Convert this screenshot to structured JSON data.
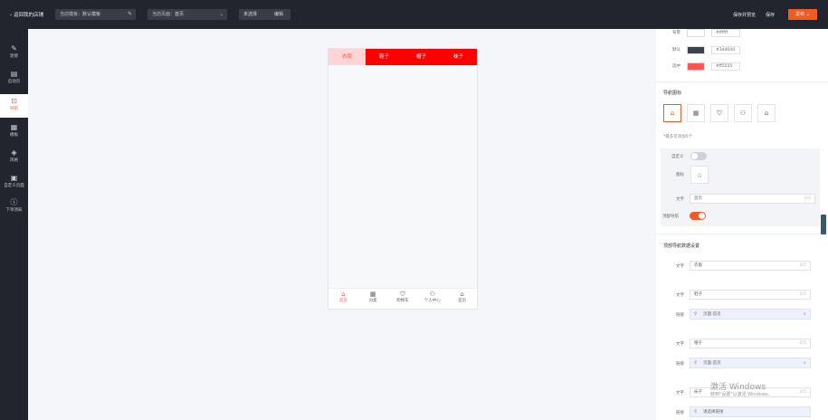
{
  "topbar": {
    "back_label": "‹ 返回我的店铺",
    "template_label": "当前模板：",
    "template_value": "默认模板",
    "page_label": "当前页面：",
    "page_value": "首页",
    "unselected_label": "未选择",
    "unselected_edit": "编辑",
    "save_preview": "保存并预览",
    "save": "保存",
    "publish": "发布 ⌄"
  },
  "leftnav": [
    {
      "icon": "✎",
      "label": "装修"
    },
    {
      "icon": "▤",
      "label": "启动页"
    },
    {
      "icon": "⊡",
      "label": "导航"
    },
    {
      "icon": "▦",
      "label": "模板"
    },
    {
      "icon": "◈",
      "label": "风格"
    },
    {
      "icon": "▣",
      "label": "自定义页面"
    },
    {
      "icon": "ⓘ",
      "label": "下单须知"
    }
  ],
  "phone": {
    "tabs": [
      "衣服",
      "鞋子",
      "帽子",
      "袜子"
    ],
    "tabbar": [
      {
        "icon": "⌂",
        "label": "首页"
      },
      {
        "icon": "▦",
        "label": "分类"
      },
      {
        "icon": "⛉",
        "label": "购物车"
      },
      {
        "icon": "⚇",
        "label": "个人中心"
      },
      {
        "icon": "⌂",
        "label": "首页"
      }
    ]
  },
  "panel": {
    "colors": [
      {
        "label": "背景",
        "hex": "#ffffff",
        "swatch": "#ffffff"
      },
      {
        "label": "默认",
        "hex": "#3d404d",
        "swatch": "#3d404d"
      },
      {
        "label": "选中",
        "hex": "#ff5555",
        "swatch": "#ff5555"
      }
    ],
    "nav_icon_title": "导航图标",
    "icon_buttons": [
      "⌂",
      "▦",
      "⛉",
      "⚇",
      "⌂"
    ],
    "note_star": "*",
    "note": "最多可添加5个",
    "custom_label": "自定义",
    "icon_label": "图标",
    "icon_preview": "⌂",
    "text_label": "文字",
    "text_value": "首页",
    "text_count": "2/5",
    "top_nav_label": "顶部导航",
    "top_nav_title": "顶部导航数据设置",
    "items": [
      {
        "text_label": "文字",
        "text": "衣服",
        "count": "2/5"
      },
      {
        "text_label": "文字",
        "text": "鞋子",
        "count": "2/5",
        "link_label": "链接",
        "link": "页面-首页"
      },
      {
        "text_label": "文字",
        "text": "帽子",
        "count": "2/5",
        "link_label": "链接",
        "link": "页面-首页"
      },
      {
        "text_label": "文字",
        "text": "袜子",
        "count": "2/5",
        "link_label": "链接",
        "link": "请选择链接"
      }
    ],
    "watermark_title": "激活 Windows",
    "watermark_sub": "转到\"设置\"以激活 Windows。"
  },
  "colors": {
    "topbar_bg": "#23252e",
    "accent": "#f15a24",
    "tab_red": "#ff0000",
    "tab_selected_bg": "#ffd4d4",
    "selected_text": "#ff5555"
  }
}
